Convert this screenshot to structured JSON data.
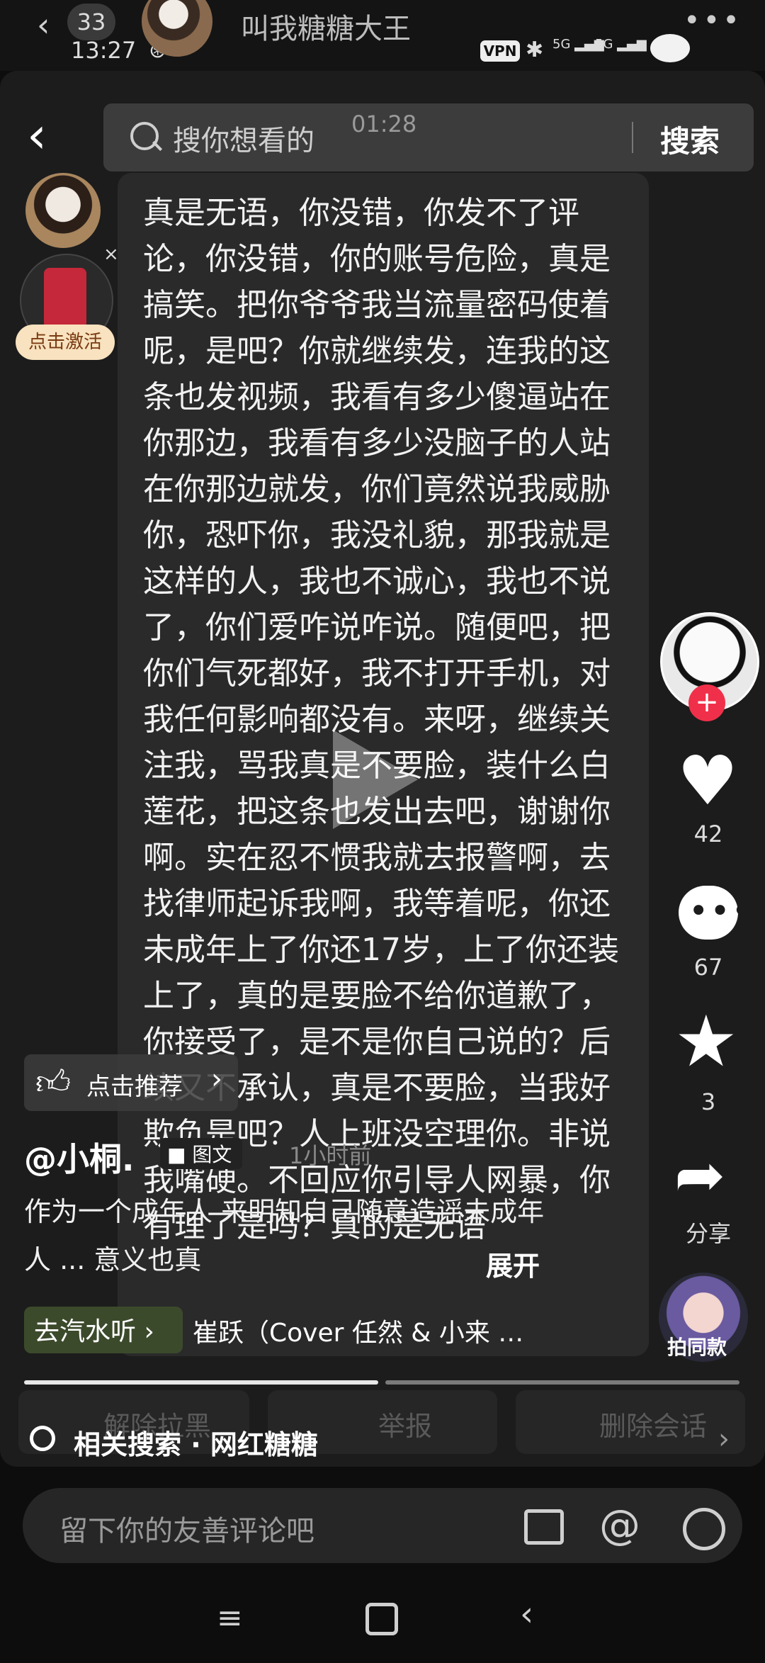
{
  "chat_header": {
    "unread": "33",
    "time": "13:27",
    "title": "叫我糖糖大王",
    "status_extra": "⊛ ···",
    "more": "•••",
    "vpn": "VPN",
    "sig1": "5G",
    "sig2": "5G"
  },
  "video": {
    "search_placeholder": "搜你想看的",
    "timer": "01:28",
    "search_button": "搜索",
    "activate": "点击激活",
    "redpack_close": "×",
    "post_text": "真是无语，你没错，你发不了评论，你没错，你的账号危险，真是搞笑。把你爷爷我当流量密码使着呢，是吧？你就继续发，连我的这条也发视频，我看有多少傻逼站在你那边，我看有多少没脑子的人站在你那边就发，你们竟然说我威胁你，恐吓你，我没礼貌，那我就是这样的人，我也不诚心，我也不说了，你们爱咋说咋说。随便吧，把你们气死都好，我不打开手机，对我任何影响都没有。来呀，继续关注我，骂我真是不要脸，装什么白莲花，把这条也发出去吧，谢谢你啊。实在忍不惯我就去报警啊，去找律师起诉我啊，我等着呢，你还未成年上了你还17岁，上了你还装上了，真的是要脸不给你道歉了，你接受了，是不是你自己说的？后续又不承认，真是不要脸，当我好欺负是吧？人上班没空理你。非说我嘴硬。不回应你引导人网暴，你有理了是吗？真的是无语",
    "like_count": "42",
    "comment_count": "67",
    "star_count": "3",
    "share_label": "分享",
    "same_style": "拍同款",
    "follow_plus": "+",
    "recommend": "点击推荐",
    "author": "@小桐.",
    "tag": "图文",
    "post_time": "1小时前",
    "description": "作为一个成年人 来明知自己随意造谣未成年人 ... 意义也真",
    "expand": "展开",
    "music_chip": "去汽水听",
    "music_title": "崔跃（Cover 任然 & 小来 …",
    "related_search": "相关搜索 · 网红糖糖"
  },
  "chat_actions": [
    "解除拉黑",
    "举报",
    "删除会话"
  ],
  "comment_input": {
    "placeholder": "留下你的友善评论吧"
  },
  "icons": [
    "back-icon",
    "search-icon",
    "heart-icon",
    "comment-icon",
    "star-icon",
    "share-icon",
    "image-icon",
    "at-icon",
    "emoji-icon",
    "menu-icon",
    "home-icon",
    "nav-back-icon"
  ]
}
